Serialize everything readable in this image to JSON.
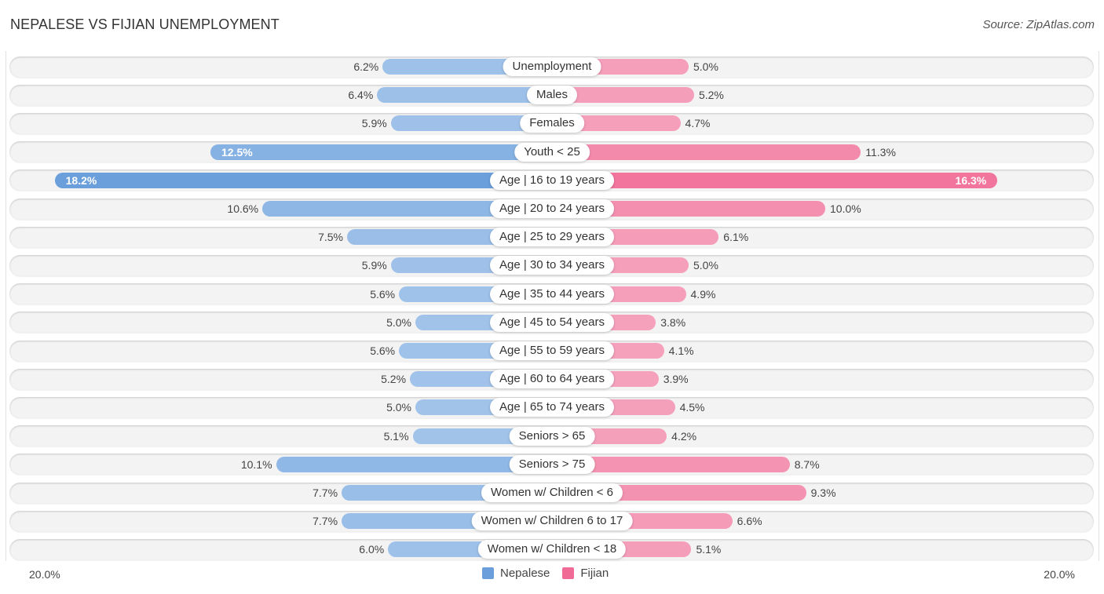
{
  "header": {
    "title": "NEPALESE VS FIJIAN UNEMPLOYMENT",
    "source": "Source: ZipAtlas.com"
  },
  "colors": {
    "nepalese": "#6a9fdc",
    "nepalese_light": "#a9c8ec",
    "fijian": "#f06b96",
    "fijian_light": "#f6a6bf"
  },
  "chart_data": {
    "type": "bar",
    "orientation": "horizontal-diverging",
    "title": "NEPALESE VS FIJIAN UNEMPLOYMENT",
    "xlim": [
      -20,
      20
    ],
    "axis_labels": {
      "left": "20.0%",
      "right": "20.0%"
    },
    "legend": {
      "position": "bottom-center",
      "entries": [
        "Nepalese",
        "Fijian"
      ]
    },
    "categories": [
      "Unemployment",
      "Males",
      "Females",
      "Youth < 25",
      "Age | 16 to 19 years",
      "Age | 20 to 24 years",
      "Age | 25 to 29 years",
      "Age | 30 to 34 years",
      "Age | 35 to 44 years",
      "Age | 45 to 54 years",
      "Age | 55 to 59 years",
      "Age | 60 to 64 years",
      "Age | 65 to 74 years",
      "Seniors > 65",
      "Seniors > 75",
      "Women w/ Children < 6",
      "Women w/ Children 6 to 17",
      "Women w/ Children < 18"
    ],
    "series": [
      {
        "name": "Nepalese",
        "values": [
          6.2,
          6.4,
          5.9,
          12.5,
          18.2,
          10.6,
          7.5,
          5.9,
          5.6,
          5.0,
          5.6,
          5.2,
          5.0,
          5.1,
          10.1,
          7.7,
          7.7,
          6.0
        ],
        "labels": [
          "6.2%",
          "6.4%",
          "5.9%",
          "12.5%",
          "18.2%",
          "10.6%",
          "7.5%",
          "5.9%",
          "5.6%",
          "5.0%",
          "5.6%",
          "5.2%",
          "5.0%",
          "5.1%",
          "10.1%",
          "7.7%",
          "7.7%",
          "6.0%"
        ]
      },
      {
        "name": "Fijian",
        "values": [
          5.0,
          5.2,
          4.7,
          11.3,
          16.3,
          10.0,
          6.1,
          5.0,
          4.9,
          3.8,
          4.1,
          3.9,
          4.5,
          4.2,
          8.7,
          9.3,
          6.6,
          5.1
        ],
        "labels": [
          "5.0%",
          "5.2%",
          "4.7%",
          "11.3%",
          "16.3%",
          "10.0%",
          "6.1%",
          "5.0%",
          "4.9%",
          "3.8%",
          "4.1%",
          "3.9%",
          "4.5%",
          "4.2%",
          "8.7%",
          "9.3%",
          "6.6%",
          "5.1%"
        ]
      }
    ]
  }
}
